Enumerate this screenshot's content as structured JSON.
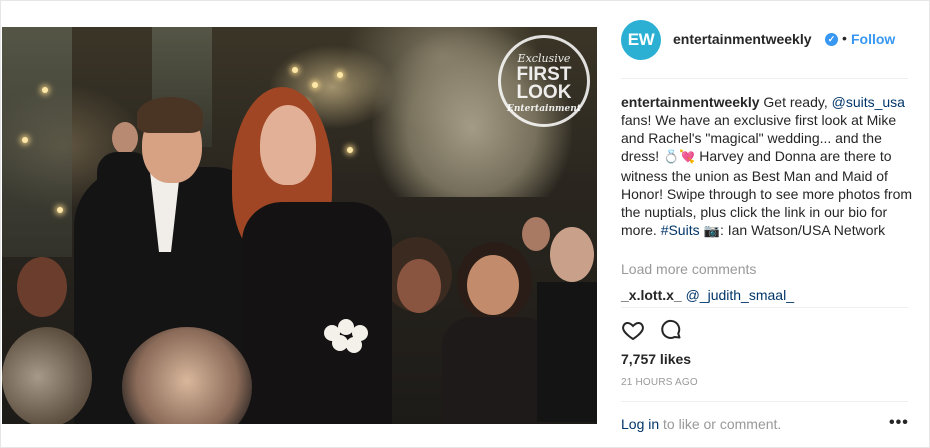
{
  "post": {
    "stamp": {
      "line1": "Exclusive",
      "line2": "FIRST LOOK",
      "line3": "Entertainment"
    },
    "carousel": {
      "count": 4,
      "active_index": 3
    }
  },
  "header": {
    "avatar_text": "EW",
    "username": "entertainmentweekly",
    "verified_icon": "verified-badge-icon",
    "separator": "•",
    "follow_label": "Follow"
  },
  "caption": {
    "username": "entertainmentweekly",
    "text1": " Get ready, ",
    "mention": "@suits_usa",
    "text2": " fans! We have an exclusive first look at Mike and Rachel's \"magical\" wedding... and the dress! ",
    "emoji1": "💍💘",
    "text3": " Harvey and Donna are there to witness the union as Best Man and Maid of Honor! Swipe through to see more photos from the nuptials, plus click the link in our bio for more. ",
    "hashtag": "#Suits",
    "emoji2": " 📷",
    "text4": ": Ian Watson/USA Network"
  },
  "load_more_label": "Load more comments",
  "comment": {
    "username": "_x.lott.x_",
    "mention": "@_judith_smaal_"
  },
  "actions": {
    "like_icon": "heart-icon",
    "comment_icon": "comment-icon"
  },
  "likes_text": "7,757 likes",
  "timestamp": "21 HOURS AGO",
  "footer": {
    "login_label": "Log in",
    "prompt": " to like or comment.",
    "more_label": "•••"
  },
  "colors": {
    "accent": "#3897f0",
    "link": "#003569",
    "muted": "#999999",
    "avatar_bg": "#2bb0d4"
  }
}
